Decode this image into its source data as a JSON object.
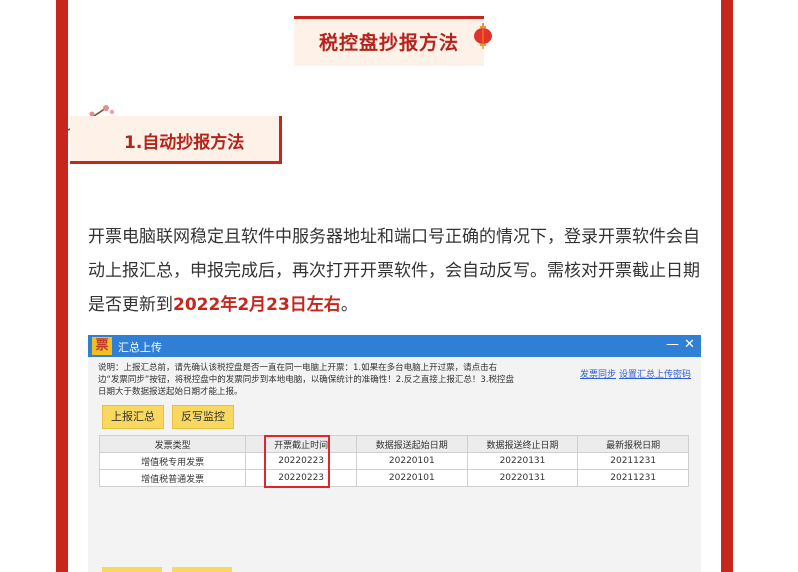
{
  "header": {
    "title": "税控盘抄报方法"
  },
  "section": {
    "heading": "1.自动抄报方法"
  },
  "body": {
    "paragraph_text": "开票电脑联网稳定且软件中服务器地址和端口号正确的情况下，登录开票软件会自动上报汇总，申报完成后，再次打开开票软件，会自动反写。需核对开票截止日期是否更新到",
    "paragraph_highlight": "2022年2月23日左右",
    "paragraph_end": "。"
  },
  "window": {
    "logo": "票",
    "title": "汇总上传",
    "minimize": "—",
    "close": "✕",
    "description": "说明：上报汇总前，请先确认该税控盘是否一直在同一电脑上开票：1.如果在多台电脑上开过票，请点击右边“发票同步”按钮，将税控盘中的发票同步到本地电脑，以确保统计的准确性！2.反之直接上报汇总！3.税控盘日期大于数据报送起始日期才能上报。",
    "link_sync": "发票同步",
    "link_settings": "设置汇总上传密码",
    "btn_report": "上报汇总",
    "btn_writeback": "反写监控",
    "table": {
      "headers": [
        "发票类型",
        "开票截止时间",
        "数据报送起始日期",
        "数据报送终止日期",
        "最新报税日期"
      ],
      "rows": [
        [
          "增值税专用发票",
          "20220223",
          "20220101",
          "20220131",
          "20211231"
        ],
        [
          "增值税普通发票",
          "20220223",
          "20220101",
          "20220131",
          "20211231"
        ]
      ]
    }
  },
  "colors": {
    "accent_red": "#c8261c",
    "title_blue": "#2f7fd6",
    "button_yellow": "#f8d85e",
    "highlight_box": "#e0262a"
  }
}
